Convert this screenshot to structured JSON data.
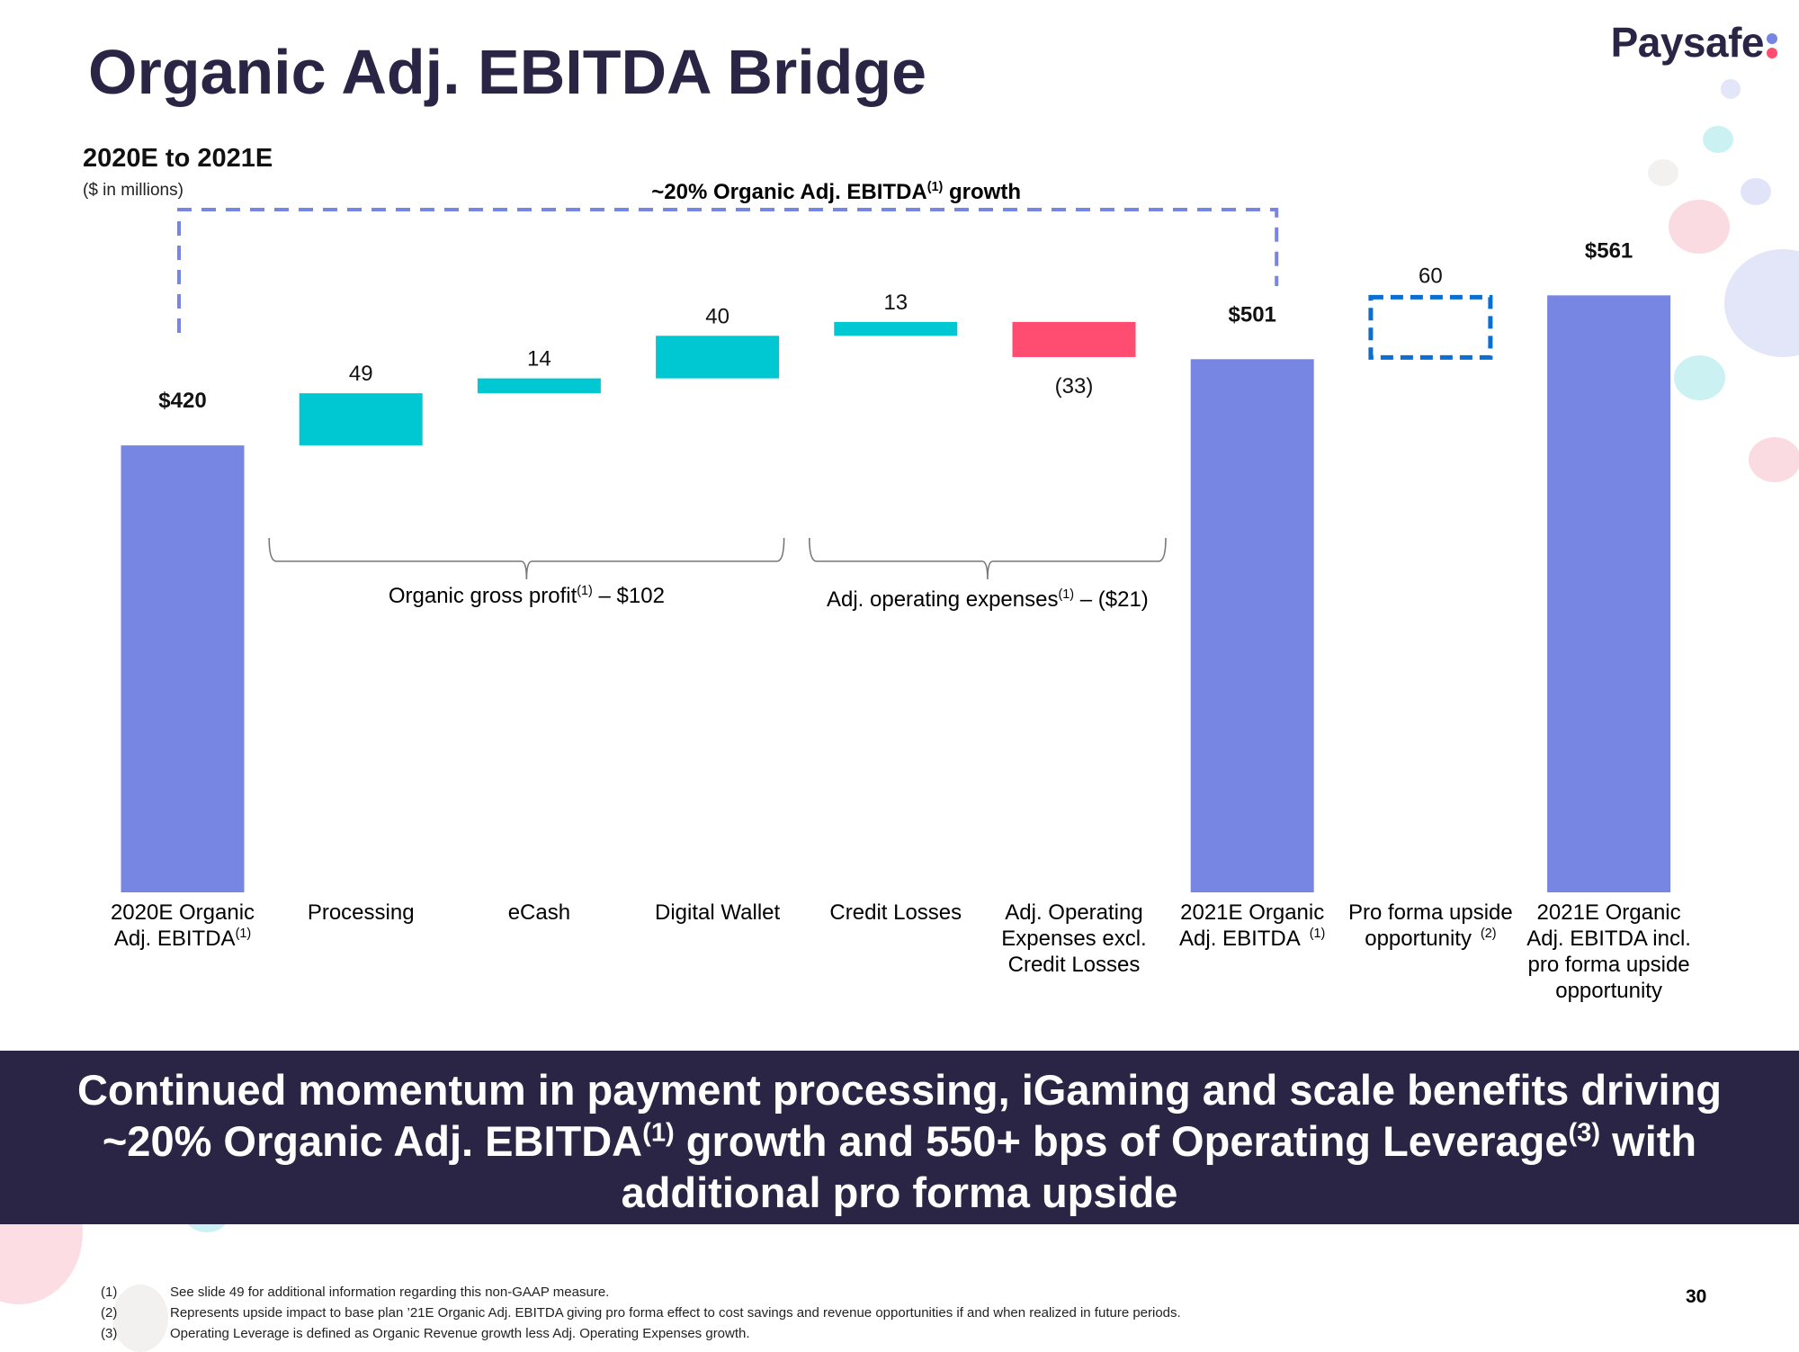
{
  "header": {
    "title": "Organic Adj. EBITDA Bridge",
    "subtitle": "2020E to 2021E",
    "units": "($ in millions)",
    "logo": "Paysafe"
  },
  "colors": {
    "total": "#7886e3",
    "increase": "#00c8d2",
    "decrease": "#ff4d72",
    "upside_outline": "#0a6fd0",
    "growth_bracket": "#7886e3",
    "brand_dark": "#2b2545",
    "logo_dot_top": "#7886e3",
    "logo_dot_bottom": "#ff4d72"
  },
  "chart_data": {
    "type": "bar",
    "subtype": "waterfall",
    "title": "Organic Adj. EBITDA Bridge",
    "subtitle": "2020E to 2021E",
    "ylabel": "$ in millions",
    "ylim": [
      0,
      600
    ],
    "grid": false,
    "categories": [
      "2020E Organic Adj. EBITDA(1)",
      "Processing",
      "eCash",
      "Digital Wallet",
      "Credit Losses",
      "Adj. Operating Expenses excl. Credit Losses",
      "2021E Organic Adj. EBITDA (1)",
      "Pro forma upside opportunity (2)",
      "2021E Organic Adj. EBITDA incl. pro forma upside opportunity"
    ],
    "bars": [
      {
        "label": [
          "2020E Organic",
          "Adj. EBITDA"
        ],
        "sup": "(1)",
        "kind": "total",
        "value": 420,
        "display": "$420"
      },
      {
        "label": [
          "Processing"
        ],
        "sup": "",
        "kind": "increase",
        "value": 49,
        "display": "49"
      },
      {
        "label": [
          "eCash"
        ],
        "sup": "",
        "kind": "increase",
        "value": 14,
        "display": "14"
      },
      {
        "label": [
          "Digital Wallet"
        ],
        "sup": "",
        "kind": "increase",
        "value": 40,
        "display": "40"
      },
      {
        "label": [
          "Credit Losses"
        ],
        "sup": "",
        "kind": "increase",
        "value": 13,
        "display": "13"
      },
      {
        "label": [
          "Adj. Operating",
          "Expenses excl.",
          "Credit Losses"
        ],
        "sup": "",
        "kind": "decrease",
        "value": -33,
        "display": "(33)"
      },
      {
        "label": [
          "2021E Organic",
          "Adj. EBITDA"
        ],
        "sup": "(1)",
        "kind": "total",
        "value": 501,
        "display": "$501"
      },
      {
        "label": [
          "Pro forma upside",
          "opportunity"
        ],
        "sup": "(2)",
        "kind": "upside",
        "value": 60,
        "display": "60"
      },
      {
        "label": [
          "2021E Organic",
          "Adj. EBITDA incl.",
          "pro forma upside",
          "opportunity"
        ],
        "sup": "",
        "kind": "total",
        "value": 561,
        "display": "$561"
      }
    ],
    "annotations": {
      "growth": {
        "text": "~20% Organic Adj. EBITDA",
        "sup": "(1)",
        "suffix": " growth",
        "from_bar": 0,
        "to_bar": 6
      },
      "brackets": [
        {
          "text": "Organic gross profit",
          "sup": "(1)",
          "suffix": " – $102",
          "from_bar": 1,
          "to_bar": 3,
          "value": 102
        },
        {
          "text": "Adj. operating expenses",
          "sup": "(1)",
          "suffix": " – ($21)",
          "from_bar": 4,
          "to_bar": 5,
          "value": -21
        }
      ]
    }
  },
  "banner": {
    "line1": "Continued momentum in payment processing, iGaming and scale benefits driving",
    "line2_a": "~20% Organic Adj. EBITDA",
    "line2_sup1": "(1)",
    "line2_b": " growth and 550+ bps of Operating Leverage",
    "line2_sup2": "(3)",
    "line2_c": " with",
    "line3": "additional pro forma upside"
  },
  "footnotes": [
    {
      "num": "(1)",
      "text": "See slide 49 for additional information regarding this non-GAAP measure."
    },
    {
      "num": "(2)",
      "text": "Represents upside impact to base plan ’21E Organic Adj. EBITDA giving pro forma effect to cost savings and revenue opportunities if and when realized in future periods."
    },
    {
      "num": "(3)",
      "text": "Operating Leverage is defined as Organic Revenue growth less Adj. Operating Expenses growth."
    }
  ],
  "page_number": "30"
}
